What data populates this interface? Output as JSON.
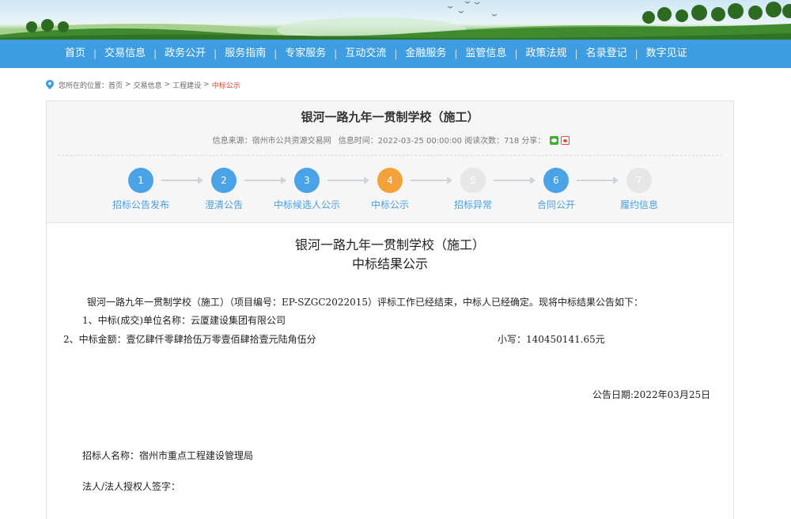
{
  "nav": {
    "items": [
      "首页",
      "交易信息",
      "政务公开",
      "服务指南",
      "专家服务",
      "互动交流",
      "金融服务",
      "监管信息",
      "政策法规",
      "名录登记",
      "数字见证"
    ]
  },
  "breadcrumb": {
    "prefix": "您所在的位置：",
    "items": [
      "首页",
      "交易信息",
      "工程建设"
    ],
    "current": "中标公示"
  },
  "header": {
    "title": "银河一路九年一贯制学校（施工）",
    "source_label": "信息来源：宿州市公共资源交易网",
    "time_label": "信息时间：2022-03-25 00:00:00 阅读次数：718 分享："
  },
  "steps": [
    {
      "num": "1",
      "label": "招标公告发布",
      "state": "done"
    },
    {
      "num": "2",
      "label": "澄清公告",
      "state": "done"
    },
    {
      "num": "3",
      "label": "中标候选人公示",
      "state": "done"
    },
    {
      "num": "4",
      "label": "中标公示",
      "state": "current"
    },
    {
      "num": "5",
      "label": "招标异常",
      "state": "inactive"
    },
    {
      "num": "6",
      "label": "合同公开",
      "state": "done"
    },
    {
      "num": "7",
      "label": "履约信息",
      "state": "inactive"
    }
  ],
  "document": {
    "title_line1": "银河一路九年一贯制学校（施工）",
    "title_line2": "中标结果公示",
    "intro": "银河一路九年一贯制学校（施工）（项目编号：EP-SZGC2022015）评标工作已经结束，中标人已经确定。现将中标结果公告如下：",
    "item1": "1、中标(成交)单位名称：云厦建设集团有限公司",
    "item2": "2、中标金额：壹亿肆仟零肆拾伍万零壹佰肆拾壹元陆角伍分",
    "item2_small": "小写：140450141.65元",
    "date": "公告日期:2022年03月25日",
    "tenderer": "招标人名称：宿州市重点工程建设管理局",
    "legal_rep": "法人/法人授权人签字："
  },
  "colors": {
    "nav_bg": "#3d9de0",
    "step_done": "#4aa3e6",
    "step_current": "#f5a13a",
    "step_inactive": "#e7e7e7",
    "breadcrumb_current": "#e0412e"
  }
}
